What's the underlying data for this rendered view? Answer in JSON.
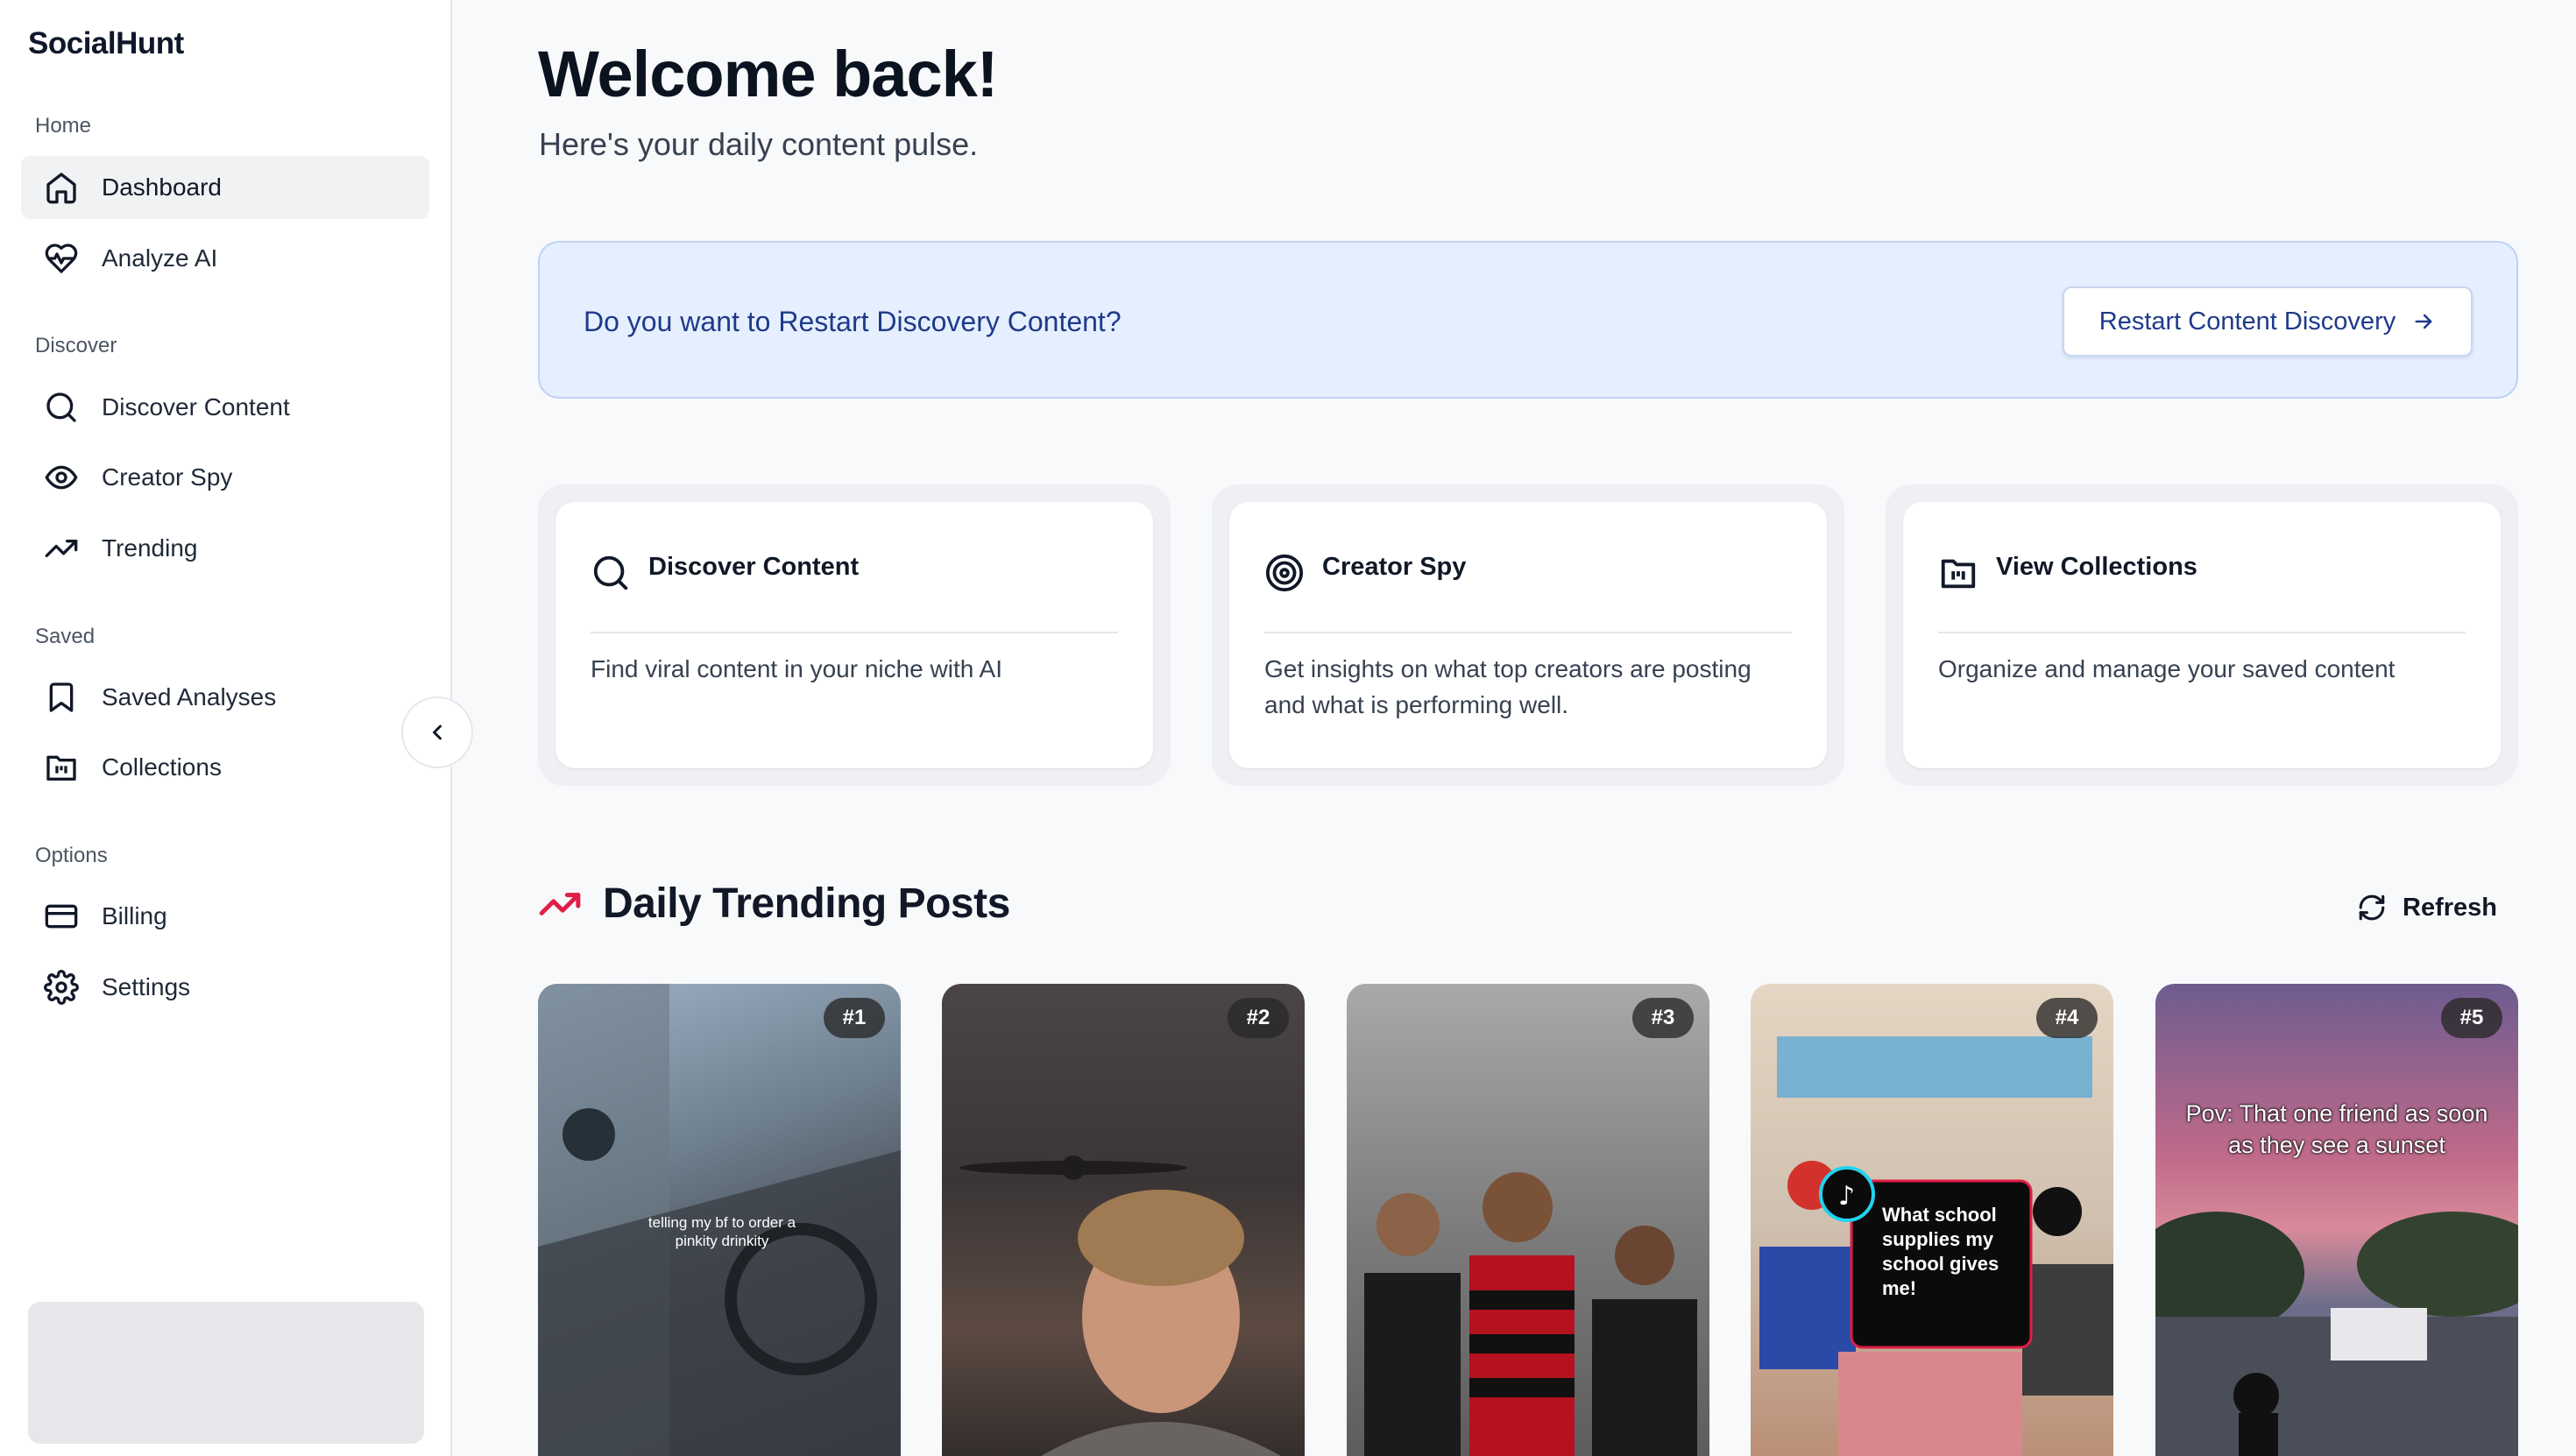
{
  "sidebar": {
    "brand": "SocialHunt",
    "sections": {
      "home": "Home",
      "discover": "Discover",
      "saved": "Saved",
      "options": "Options"
    },
    "items": {
      "dashboard": {
        "label": "Dashboard",
        "icon": "home-icon",
        "active": true
      },
      "analyze": {
        "label": "Analyze AI",
        "icon": "heart-pulse-icon"
      },
      "discover_content": {
        "label": "Discover Content",
        "icon": "search-icon"
      },
      "creator_spy": {
        "label": "Creator Spy",
        "icon": "eye-icon"
      },
      "trending": {
        "label": "Trending",
        "icon": "trending-up-icon"
      },
      "saved_analyses": {
        "label": "Saved Analyses",
        "icon": "bookmark-icon"
      },
      "collections": {
        "label": "Collections",
        "icon": "folder-icon"
      },
      "billing": {
        "label": "Billing",
        "icon": "credit-card-icon"
      },
      "settings": {
        "label": "Settings",
        "icon": "gear-icon"
      }
    }
  },
  "header": {
    "title": "Welcome back!",
    "subtitle": "Here's your daily content pulse."
  },
  "banner": {
    "question": "Do you want to Restart Discovery Content?",
    "button_label": "Restart Content Discovery"
  },
  "cards": [
    {
      "title": "Discover Content",
      "icon": "search-icon",
      "description": "Find viral content in your niche with AI"
    },
    {
      "title": "Creator Spy",
      "icon": "target-icon",
      "description": "Get insights on what top creators are posting and what is performing well."
    },
    {
      "title": "View Collections",
      "icon": "folder-icon",
      "description": "Organize and manage your saved content"
    }
  ],
  "trending": {
    "title": "Daily Trending Posts",
    "refresh_label": "Refresh",
    "posts": [
      {
        "rank": "#1",
        "caption": "telling my bf to order a pinkity drinkity"
      },
      {
        "rank": "#2",
        "caption": ""
      },
      {
        "rank": "#3",
        "caption": ""
      },
      {
        "rank": "#4",
        "caption": "What school supplies my school gives me!"
      },
      {
        "rank": "#5",
        "caption": "Pov: That one friend as soon as they see a sunset"
      }
    ]
  },
  "colors": {
    "accent": "#1e3a8a",
    "banner_bg": "#e6efff",
    "trend_red": "#e11d48"
  }
}
